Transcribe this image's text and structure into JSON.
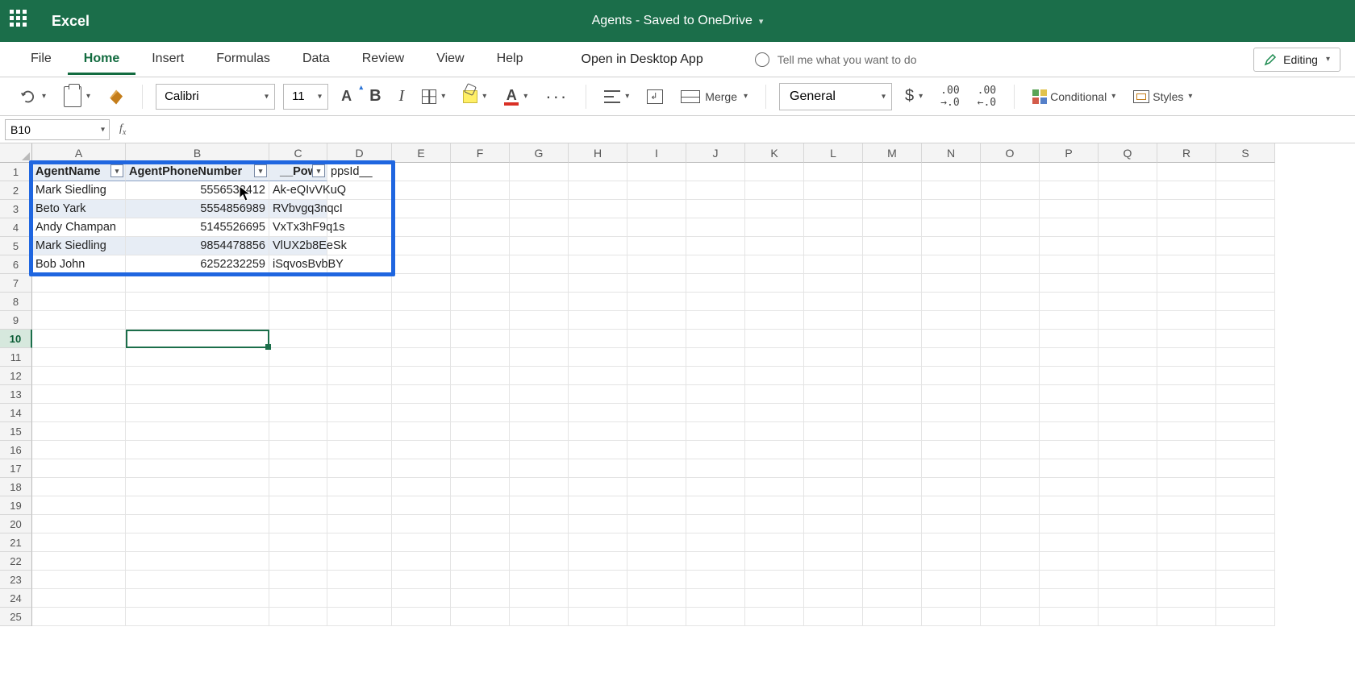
{
  "header": {
    "app_name": "Excel",
    "doc_title": "Agents - Saved to OneDrive"
  },
  "tabs": {
    "file": "File",
    "home": "Home",
    "insert": "Insert",
    "formulas": "Formulas",
    "data": "Data",
    "review": "Review",
    "view": "View",
    "help": "Help",
    "open_desktop": "Open in Desktop App",
    "tell_me": "Tell me what you want to do",
    "editing": "Editing"
  },
  "ribbon": {
    "font_name": "Calibri",
    "font_size": "11",
    "merge_label": "Merge",
    "number_format": "General",
    "conditional": "Conditional",
    "styles": "Styles"
  },
  "formula_bar": {
    "name_box": "B10",
    "formula": ""
  },
  "cols_std": [
    "E",
    "F",
    "G",
    "H",
    "I",
    "J",
    "K",
    "L",
    "M",
    "N",
    "O",
    "P",
    "Q",
    "R",
    "S"
  ],
  "table": {
    "headers": {
      "a": "AgentName",
      "b": "AgentPhoneNumber",
      "c": "__Powe",
      "d": "ppsId__"
    },
    "rows": [
      {
        "name": "Mark Siedling",
        "phone": "5556532412",
        "id": "Ak-eQIvVKuQ"
      },
      {
        "name": "Beto Yark",
        "phone": "5554856989",
        "id": "RVbvgq3nqcI"
      },
      {
        "name": "Andy Champan",
        "phone": "5145526695",
        "id": "VxTx3hF9q1s"
      },
      {
        "name": "Mark Siedling",
        "phone": "9854478856",
        "id": "VlUX2b8EeSk"
      },
      {
        "name": "Bob John",
        "phone": "6252232259",
        "id": "iSqvosBvbBY"
      }
    ]
  },
  "rows_extra": [
    "7",
    "8",
    "9",
    "10",
    "11",
    "12",
    "13",
    "14",
    "15",
    "16",
    "17",
    "18",
    "19",
    "20",
    "21",
    "22",
    "23",
    "24",
    "25"
  ]
}
